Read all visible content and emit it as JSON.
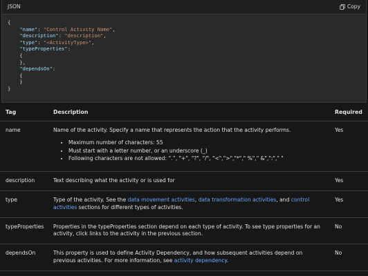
{
  "code_block": {
    "language": "JSON",
    "copy_label": "Copy",
    "lines": [
      "{",
      "    \"name\": \"Control Activity Name\",",
      "    \"description\": \"description\",",
      "    \"type\": \"<ActivityType>\",",
      "    \"typeProperties\":",
      "    {",
      "    },",
      "    \"dependsOn\":",
      "    {",
      "    }",
      "}"
    ]
  },
  "table": {
    "headers": [
      "Tag",
      "Description",
      "Required"
    ],
    "rows": {
      "name": {
        "tag": "name",
        "desc": "Name of the activity. Specify a name that represents the action that the activity performs.",
        "bullets": [
          "Maximum number of characters: 55",
          "Must start with a letter number, or an underscore (_)",
          "Following characters are not allowed: “.”, \"+\", \"?\", \"/\", \"<\",\">\",\"*\",\" %\",\" &\",\":\",\" \""
        ],
        "required": "Yes"
      },
      "description": {
        "tag": "description",
        "desc": "Text describing what the activity or is used for",
        "required": "Yes"
      },
      "type": {
        "tag": "type",
        "desc_pre": "Type of the activity. See the ",
        "link1": "data movement activities",
        "sep1": ", ",
        "link2": "data transformation activities",
        "sep2": ", and ",
        "link3": "control activities",
        "desc_post": " sections for different types of activities.",
        "required": "Yes"
      },
      "typeProperties": {
        "tag": "typeProperties",
        "desc": "Properties in the typeProperties section depend on each type of activity. To see type properties for an activity, click links to the activity in the previous section.",
        "required": "No"
      },
      "dependsOn": {
        "tag": "dependsOn",
        "desc_pre": "This property is used to define Activity Dependency, and how subsequent activities depend on previous activities. For more information, see ",
        "link": "activity dependency",
        "desc_post": ".",
        "required": "No"
      }
    }
  }
}
